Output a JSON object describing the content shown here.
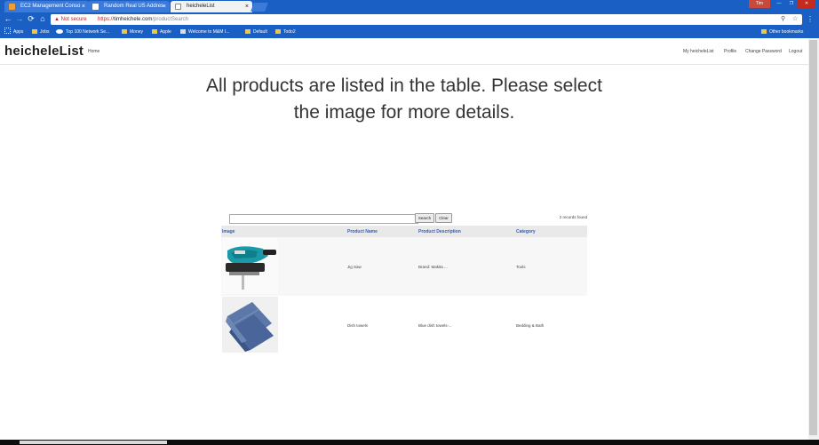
{
  "browser": {
    "tabs": [
      {
        "title": "EC2 Management Conso",
        "close": "×",
        "icon_color": "#f0a030"
      },
      {
        "title": "Random Real US Addres",
        "close": "×",
        "icon_color": "#ffffff"
      },
      {
        "title": "heicheleList",
        "close": "×",
        "icon_color": "#888888"
      }
    ],
    "window_user": "Tim",
    "nav": {
      "back": "←",
      "forward": "→",
      "reload": "⟳",
      "home": "⌂"
    },
    "address": {
      "warning": "▲ Not secure",
      "scheme": "https://",
      "host": "timheichele.com",
      "path": "/productSearch"
    },
    "bookmarks": {
      "apps": "Apps",
      "items": [
        "Jobs",
        "Top 100 Network Se...",
        "Money",
        "Apple",
        "Welcome to M&M I...",
        "Default",
        "Todo2"
      ],
      "other": "Other bookmarks"
    }
  },
  "site": {
    "brand": "heicheleList",
    "nav_left": [
      "Home"
    ],
    "nav_right": [
      "My heicheleList",
      "Profile",
      "Change Password",
      "Logout"
    ]
  },
  "main": {
    "headline": "All products are listed in the table. Please select the image for more details.",
    "search": {
      "placeholder": "",
      "value": "",
      "search_label": "Search",
      "clear_label": "Clear"
    },
    "records_text": "2 records found",
    "table": {
      "headers": [
        "Image",
        "Product Name",
        "Product Description",
        "Category"
      ],
      "rows": [
        {
          "image": "jigsaw-image",
          "name": "Jig Saw",
          "description": "Brand: Makita ...",
          "category": "Tools"
        },
        {
          "image": "towels-image",
          "name": "Dish towels",
          "description": "Blue dish towels-...",
          "category": "Bedding & Bath"
        }
      ]
    }
  },
  "colors": {
    "chrome": "#1a5fc4",
    "link": "#2b60c5",
    "row_alt": "#f7f7f7"
  }
}
